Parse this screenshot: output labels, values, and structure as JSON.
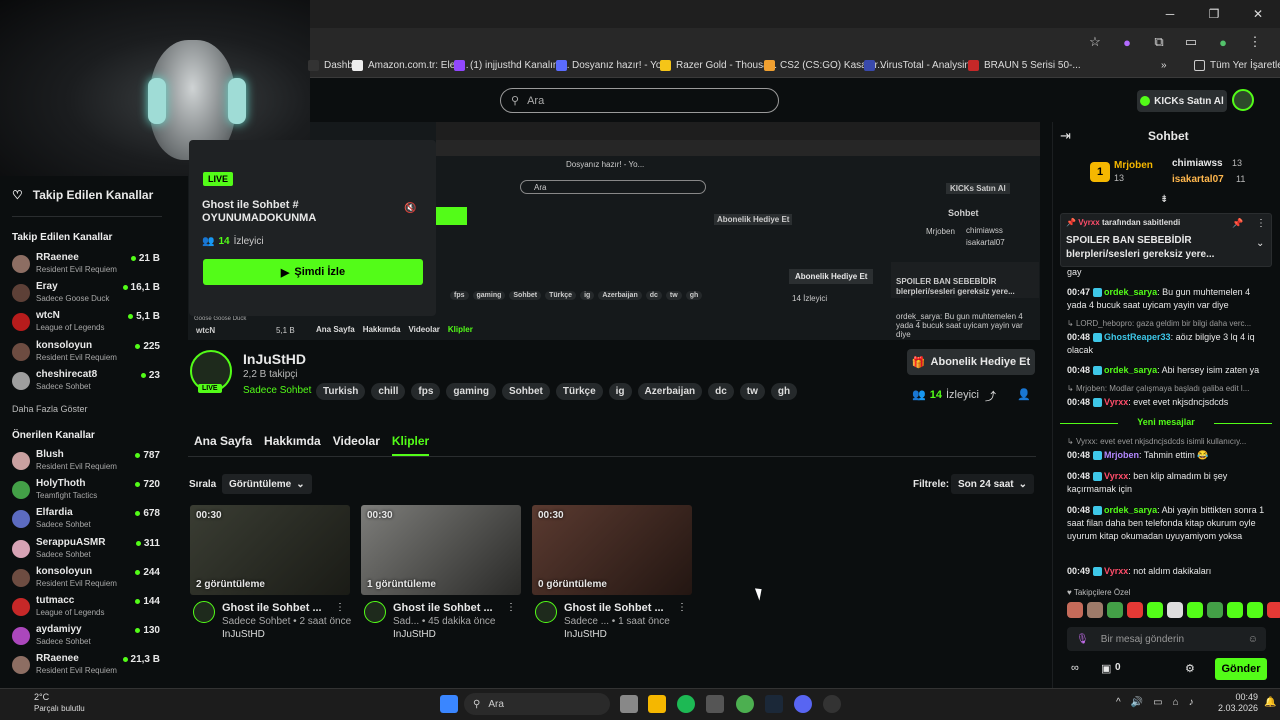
{
  "browser": {
    "bookmarks": [
      {
        "label": "Dashb...",
        "color": "#333"
      },
      {
        "label": "Amazon.com.tr: Elek...",
        "color": "#eee"
      },
      {
        "label": "(1) injjusthd Kanalını...",
        "color": "#9147ff"
      },
      {
        "label": "Dosyanız hazır! - Yo...",
        "color": "#5b6cff"
      },
      {
        "label": "Razer Gold - Thousa...",
        "color": "#f5c518"
      },
      {
        "label": "CS2 (CS:GO) Kasalar...",
        "color": "#f0a030"
      },
      {
        "label": "VirusTotal - Analysin...",
        "color": "#3949ab"
      },
      {
        "label": "BRAUN 5 Serisi 50-...",
        "color": "#c62828"
      }
    ],
    "all_bookmarks": "Tüm Yer İşaretleri",
    "chevron": "»"
  },
  "header": {
    "search_placeholder": "Ara",
    "kicks_button": "KICKs Satın Al"
  },
  "sidebar": {
    "followed_title": "Takip Edilen Kanallar",
    "followed_section": "Takip Edilen Kanallar",
    "followed": [
      {
        "name": "RRaenee",
        "game": "Resident Evil Requiem",
        "viewers": "21 B",
        "color": "#8d6e63"
      },
      {
        "name": "Eray",
        "game": "Sadece Goose Duck",
        "viewers": "16,1 B",
        "color": "#5d4037"
      },
      {
        "name": "wtcN",
        "game": "League of Legends",
        "viewers": "5,1 B",
        "color": "#b71c1c"
      },
      {
        "name": "konsoloyun",
        "game": "Resident Evil Requiem",
        "viewers": "225",
        "color": "#6d4c41"
      },
      {
        "name": "cheshirecat8",
        "game": "Sadece Sohbet",
        "viewers": "23",
        "color": "#9e9e9e"
      }
    ],
    "show_more": "Daha Fazla Göster",
    "recommended_section": "Önerilen Kanallar",
    "recommended": [
      {
        "name": "Blush",
        "game": "Resident Evil Requiem",
        "viewers": "787",
        "color": "#c9a0a0"
      },
      {
        "name": "HolyThoth",
        "game": "Teamfight Tactics",
        "viewers": "720",
        "color": "#43a047"
      },
      {
        "name": "Elfardia",
        "game": "Sadece Sohbet",
        "viewers": "678",
        "color": "#5c6bc0"
      },
      {
        "name": "SerappuASMR",
        "game": "Sadece Sohbet",
        "viewers": "311",
        "color": "#d7a3b5"
      },
      {
        "name": "konsoloyun",
        "game": "Resident Evil Requiem",
        "viewers": "244",
        "color": "#6d4c41"
      },
      {
        "name": "tutmacc",
        "game": "League of Legends",
        "viewers": "144",
        "color": "#c62828"
      },
      {
        "name": "aydamiyy",
        "game": "Sadece Sohbet",
        "viewers": "130",
        "color": "#ab47bc"
      },
      {
        "name": "RRaenee",
        "game": "Resident Evil Requiem",
        "viewers": "21,3 B",
        "color": "#8d6e63"
      }
    ]
  },
  "live_card": {
    "badge": "LIVE",
    "title": "Ghost ile Sohbet # OYUNUMADOKUNMA",
    "viewers_count": "14",
    "viewers_label": "İzleyici",
    "watch_button": "Şimdi İzle"
  },
  "mini": {
    "live_text": "Goose Goose Duck",
    "row_name": "wtcN",
    "row_viewers": "5,1 B",
    "tabs": [
      "Ana Sayfa",
      "Hakkımda",
      "Videolar",
      "Klipler"
    ],
    "tags": [
      "fps",
      "gaming",
      "Sohbet",
      "Türkçe",
      "ig",
      "Azerbaijan",
      "dc",
      "tw",
      "gh"
    ],
    "gift": "Abonelik Hediye Et",
    "viewers": "14 İzleyici",
    "chat_title": "Sohbet",
    "pin_title": "SPOILER BAN SEBEBİDİR",
    "pin_sub": "blerpleri/sesleri gereksiz yere...",
    "msg": "ordek_sarya: Bu gun muhtemelen 4 yada 4 bucuk saat uyicam yayin var diye",
    "search": "Ara",
    "kicks": "KICKs Satın Al",
    "top_leader1": "Mrjoben",
    "top_leader2": "chimiawss",
    "top_leader3": "isakartal07",
    "tabs_mini_bar": "Dosyanız hazır! - Yo..."
  },
  "profile": {
    "name": "InJuStHD",
    "followers": "2,2 B takipçi",
    "category": "Sadece Sohbet",
    "live": "LIVE",
    "tags": [
      "Turkish",
      "chill",
      "fps",
      "gaming",
      "Sohbet",
      "Türkçe",
      "ig",
      "Azerbaijan",
      "dc",
      "tw",
      "gh"
    ],
    "gift_button": "Abonelik Hediye Et",
    "viewers_count": "14",
    "viewers_label": "İzleyici"
  },
  "tabs": [
    "Ana Sayfa",
    "Hakkımda",
    "Videolar",
    "Klipler"
  ],
  "clips_toolbar": {
    "sort_label": "Sırala",
    "sort_value": "Görüntüleme",
    "filter_label": "Filtrele:",
    "filter_value": "Son 24 saat"
  },
  "clips": [
    {
      "duration": "00:30",
      "views": "2 görüntüleme",
      "title": "Ghost ile Sohbet ...",
      "sub": "Sadece Sohbet • 2 saat önce",
      "channel": "InJuStHD",
      "c1": "#3a3d33",
      "c2": "#1a1b16"
    },
    {
      "duration": "00:30",
      "views": "1 görüntüleme",
      "title": "Ghost ile Sohbet ...",
      "sub": "Sad... • 45 dakika önce",
      "channel": "InJuStHD",
      "c1": "#7d7d7a",
      "c2": "#2a2a28"
    },
    {
      "duration": "00:30",
      "views": "0 görüntüleme",
      "title": "Ghost ile Sohbet ...",
      "sub": "Sadece ... • 1 saat önce",
      "channel": "InJuStHD",
      "c1": "#5a3a30",
      "c2": "#231612"
    }
  ],
  "chat": {
    "title": "Sohbet",
    "leaders": [
      {
        "rank": "1",
        "name": "Mrjoben",
        "count": "13",
        "color": "#f5b700"
      },
      {
        "name": "chimiawss",
        "count": "13",
        "color": "#ffffff"
      },
      {
        "name": "isakartal07",
        "count": "11",
        "color": "#ffb74d"
      }
    ],
    "pinned_by": "Vyrxx",
    "pinned_suffix": "tarafından sabitlendi",
    "pinned_title": "SPOILER BAN SEBEBİDİR",
    "pinned_sub": "blerpleri/sesleri gereksiz yere...",
    "first_line": "gay",
    "messages_before": [
      {
        "time": "00:47",
        "user": "ordek_sarya",
        "color": "#53fc18",
        "text": "Bu gun muhtemelen 4 yada 4 bucuk saat uyicam yayin var diye",
        "reply": ""
      },
      {
        "time": "00:48",
        "user": "GhostReaper33",
        "color": "#3ec7e8",
        "text": "aöız bilgiye 3 lq 4 iq olacak",
        "reply": "LORD_hebopro: gaza geldim bir bilgi daha verc..."
      },
      {
        "time": "00:48",
        "user": "ordek_sarya",
        "color": "#53fc18",
        "text": "Abi hersey isim zaten ya",
        "reply": ""
      },
      {
        "time": "00:48",
        "user": "Vyrxx",
        "color": "#ff4d6a",
        "text": "evet evet nkjsdncjsdcds",
        "reply": "Mrjoben: Modlar çalışmaya başladı galiba edit l..."
      }
    ],
    "new_messages": "Yeni mesajlar",
    "messages_after": [
      {
        "time": "00:48",
        "user": "Mrjoben",
        "color": "#b388ff",
        "text": "Tahmin ettim 😂",
        "reply": "Vyrxx: evet evet nkjsdncjsdcds isimli kullanıcıy..."
      },
      {
        "time": "00:48",
        "user": "Vyrxx",
        "color": "#ff4d6a",
        "text": "ben klip almadım bi şey kaçırmamak için",
        "reply": ""
      },
      {
        "time": "00:48",
        "user": "ordek_sarya",
        "color": "#53fc18",
        "text": "Abi yayin bittikten sonra 1 saat filan daha ben telefonda kitap okurum oyle uyurum kitap okumadan uyuyamiyom yoksa",
        "reply": ""
      },
      {
        "time": "00:49",
        "user": "Vyrxx",
        "color": "#ff4d6a",
        "text": "not aldım dakikaları",
        "reply": ""
      }
    ],
    "emote_label": "Takipçilere Özel",
    "emote_colors": [
      "#c56b5a",
      "#9e7b6a",
      "#43a047",
      "#e53935",
      "#53fc18",
      "#ddd",
      "#53fc18",
      "#43a047",
      "#53fc18",
      "#53fc18",
      "#e53935"
    ],
    "input_placeholder": "Bir mesaj gönderin",
    "points": "0",
    "send_button": "Gönder"
  },
  "taskbar": {
    "temp": "2°C",
    "weather": "Parçalı bulutlu",
    "search": "Ara",
    "time": "00:49",
    "date": "2.03.2026"
  }
}
